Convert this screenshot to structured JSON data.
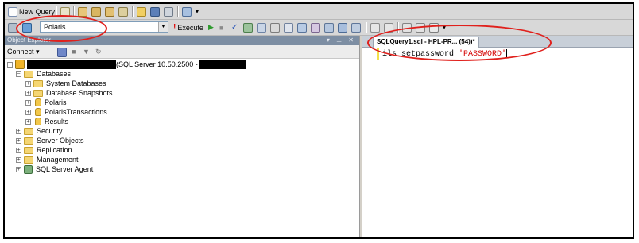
{
  "toolbar1": {
    "new_query_label": "New Query"
  },
  "toolbar2": {
    "database_selected": "Polaris",
    "execute_label": "Execute",
    "execute_prefix": "!"
  },
  "object_explorer": {
    "title": "Object Explorer",
    "window_controls": "▾ ⊥ ✕",
    "connect_label": "Connect ▾",
    "server_suffix": "(SQL Server 10.50.2500 -",
    "tree": [
      {
        "label": "Databases",
        "expander": "⊟"
      },
      {
        "label": "System Databases",
        "expander": "⊞"
      },
      {
        "label": "Database Snapshots",
        "expander": "⊞"
      },
      {
        "label": "Polaris",
        "expander": "⊞"
      },
      {
        "label": "PolarisTransactions",
        "expander": "⊞"
      },
      {
        "label": "Results",
        "expander": "⊞"
      },
      {
        "label": "Security",
        "expander": "⊞"
      },
      {
        "label": "Server Objects",
        "expander": "⊞"
      },
      {
        "label": "Replication",
        "expander": "⊞"
      },
      {
        "label": "Management",
        "expander": "⊞"
      },
      {
        "label": "SQL Server Agent",
        "expander": "⊞"
      }
    ]
  },
  "query_editor": {
    "tab_title": "SQLQuery1.sql - HPL-PR... (54))*",
    "code_proc": "ils_setpassword ",
    "code_string": "'PASSWORD'"
  },
  "colors": {
    "annotation": "#e0201c",
    "string_literal": "#d40000"
  }
}
